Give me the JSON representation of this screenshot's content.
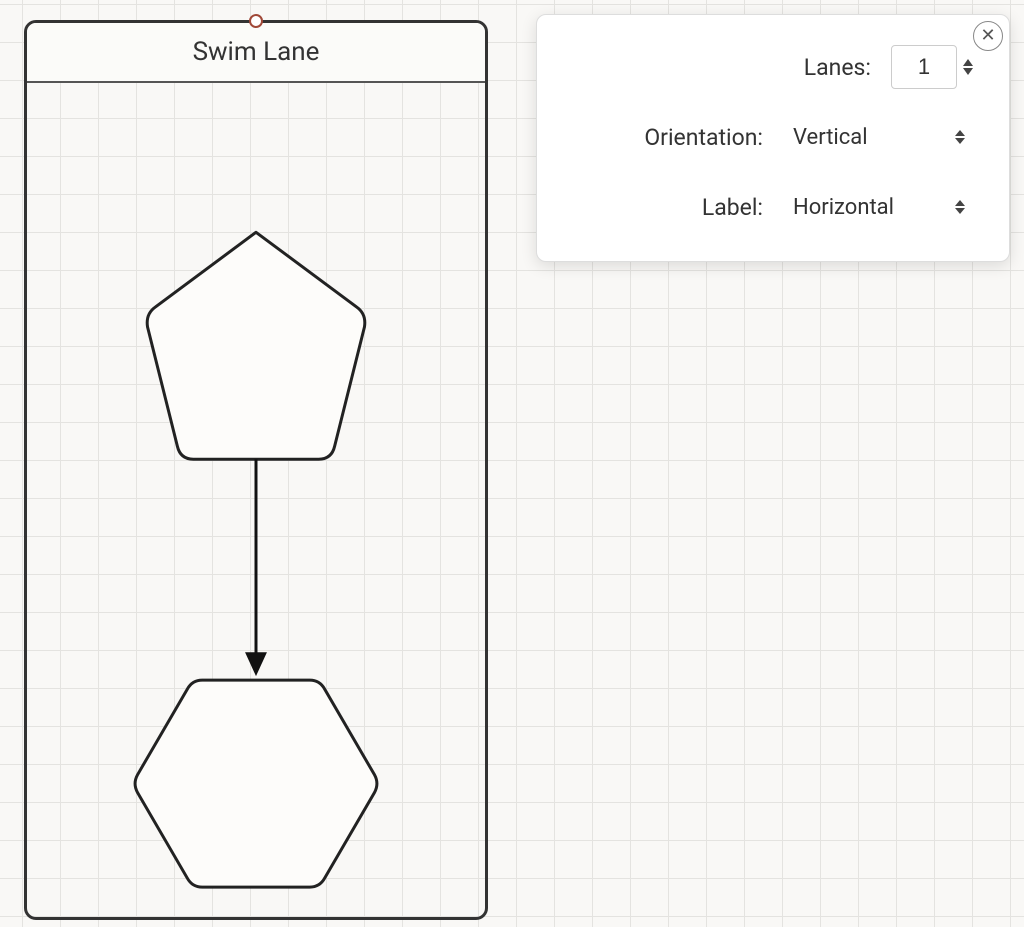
{
  "swimlane": {
    "title": "Swim Lane",
    "shapes": [
      {
        "name": "pentagon-shape",
        "type": "pentagon"
      },
      {
        "name": "hexagon-shape",
        "type": "hexagon"
      }
    ],
    "connectors": [
      {
        "name": "arrow-connector",
        "from": "pentagon-shape",
        "to": "hexagon-shape"
      }
    ]
  },
  "panel": {
    "lanes_label": "Lanes:",
    "lanes_value": "1",
    "orientation_label": "Orientation:",
    "orientation_value": "Vertical",
    "label_label": "Label:",
    "label_value": "Horizontal"
  }
}
